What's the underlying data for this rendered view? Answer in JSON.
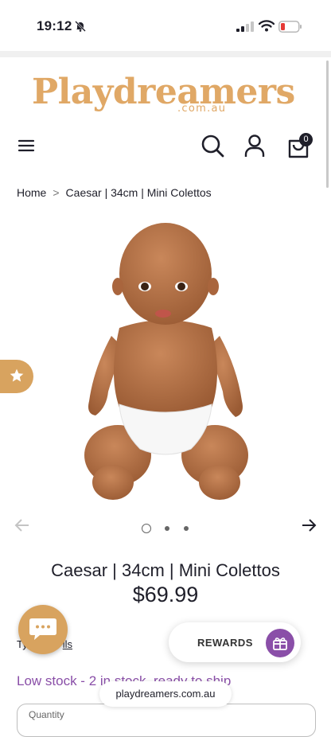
{
  "status_bar": {
    "time": "19:12"
  },
  "header": {
    "logo_text": "Playdreamers",
    "logo_subtext": ".com.au",
    "cart_count": "0"
  },
  "breadcrumb": {
    "home": "Home",
    "separator": ">",
    "current": "Caesar | 34cm | Mini Colettos"
  },
  "gallery": {
    "slide_count": 3,
    "active_index": 0
  },
  "product": {
    "title": "Caesar | 34cm | Mini Colettos",
    "price": "$69.99",
    "type_prefix": "Ty",
    "type_link": "lls",
    "stock_status": "Low stock - 2 in stock, ready to ship",
    "quantity_label": "Quantity"
  },
  "widgets": {
    "rewards_label": "REWARDS"
  },
  "browser": {
    "url": "playdreamers.com.au"
  },
  "colors": {
    "brand": "#e0a866",
    "accent": "#8a4fa8",
    "text": "#1f1f2a"
  }
}
